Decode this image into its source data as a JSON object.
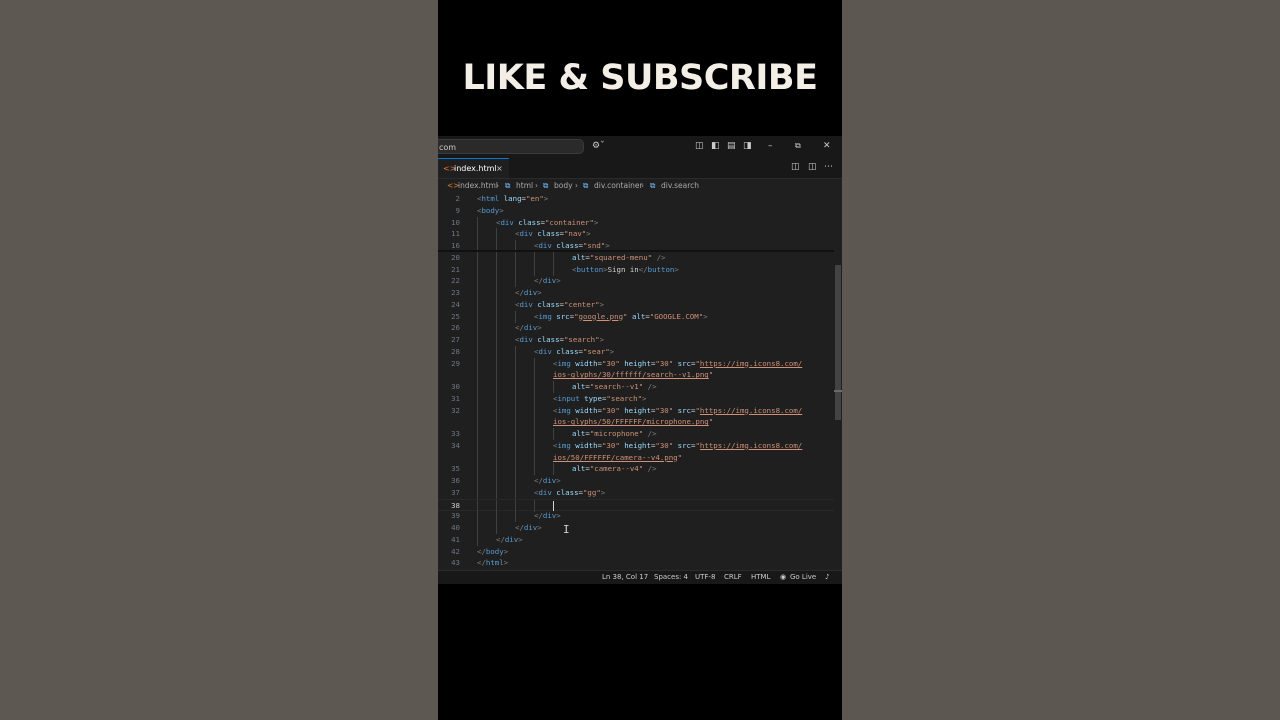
{
  "banner": {
    "text": "LIKE & SUBSCRIBE"
  },
  "titlebar": {
    "command_center_text": "com",
    "copilot_icon": "copilot-icon",
    "layout_icons": [
      "layout-panel-icon",
      "toggle-sidebar-icon",
      "toggle-panel-icon",
      "toggle-secondary-sidebar-icon"
    ],
    "window_controls": [
      "minimize-icon",
      "restore-icon",
      "close-icon"
    ]
  },
  "tab": {
    "label": "index.html",
    "close": "×"
  },
  "breadcrumbs": [
    "index.html",
    "html",
    "body",
    "div.container",
    "div.search"
  ],
  "editor_lines": [
    {
      "n": "2",
      "indent": 0,
      "html": "<span class='p'>&lt;</span><span class='t'>html</span> <span class='a'>lang</span>=<span class='s'>\"en\"</span><span class='p'>&gt;</span>"
    },
    {
      "n": "9",
      "indent": 0,
      "html": "<span class='p'>&lt;</span><span class='t'>body</span><span class='p'>&gt;</span>"
    },
    {
      "n": "10",
      "indent": 1,
      "html": "<span class='p'>&lt;</span><span class='t'>div</span> <span class='a'>class</span>=<span class='s'>\"container\"</span><span class='p'>&gt;</span>"
    },
    {
      "n": "11",
      "indent": 2,
      "html": "<span class='p'>&lt;</span><span class='t'>div</span> <span class='a'>class</span>=<span class='s'>\"nav\"</span><span class='p'>&gt;</span>"
    },
    {
      "n": "16",
      "indent": 3,
      "html": "<span class='p'>&lt;</span><span class='t'>div</span> <span class='a'>class</span>=<span class='s'>\"snd\"</span><span class='p'>&gt;</span>"
    },
    {
      "n": "20",
      "indent": 5,
      "html": "<span class='a'>alt</span>=<span class='s'>\"squared-menu\"</span> <span class='p'>/&gt;</span>"
    },
    {
      "n": "21",
      "indent": 5,
      "html": "<span class='p'>&lt;</span><span class='t'>button</span><span class='p'>&gt;</span><span class='tx'>Sign in</span><span class='p'>&lt;/</span><span class='t'>button</span><span class='p'>&gt;</span>"
    },
    {
      "n": "22",
      "indent": 3,
      "html": "<span class='p'>&lt;/</span><span class='t'>div</span><span class='p'>&gt;</span>"
    },
    {
      "n": "23",
      "indent": 2,
      "html": "<span class='p'>&lt;/</span><span class='t'>div</span><span class='p'>&gt;</span>"
    },
    {
      "n": "24",
      "indent": 2,
      "html": "<span class='p'>&lt;</span><span class='t'>div</span> <span class='a'>class</span>=<span class='s'>\"center\"</span><span class='p'>&gt;</span>"
    },
    {
      "n": "25",
      "indent": 3,
      "html": "<span class='p'>&lt;</span><span class='t'>img</span> <span class='a'>src</span>=<span class='s'>\"</span><span class='u'>google.png</span><span class='s'>\"</span> <span class='a'>alt</span>=<span class='s'>\"GOOGLE.COM\"</span><span class='p'>&gt;</span>"
    },
    {
      "n": "26",
      "indent": 2,
      "html": "<span class='p'>&lt;/</span><span class='t'>div</span><span class='p'>&gt;</span>"
    },
    {
      "n": "27",
      "indent": 2,
      "html": "<span class='p'>&lt;</span><span class='t'>div</span> <span class='a'>class</span>=<span class='s'>\"search\"</span><span class='p'>&gt;</span>"
    },
    {
      "n": "28",
      "indent": 3,
      "html": "<span class='p'>&lt;</span><span class='t'>div</span> <span class='a'>class</span>=<span class='s'>\"sear\"</span><span class='p'>&gt;</span>"
    },
    {
      "n": "29",
      "indent": 4,
      "html": "<span class='p'>&lt;</span><span class='t'>img</span> <span class='a'>width</span>=<span class='s'>\"30\"</span> <span class='a'>height</span>=<span class='s'>\"30\"</span> <span class='a'>src</span>=<span class='s'>\"</span><span class='u'>https://img.icons8.com/</span>"
    },
    {
      "n": "",
      "indent": 4,
      "html": "<span class='u'>ios-glyphs/30/ffffff/search--v1.png</span><span class='s'>\"</span>"
    },
    {
      "n": "30",
      "indent": 5,
      "html": "<span class='a'>alt</span>=<span class='s'>\"search--v1\"</span> <span class='p'>/&gt;</span>"
    },
    {
      "n": "31",
      "indent": 4,
      "html": "<span class='p'>&lt;</span><span class='t'>input</span> <span class='a'>type</span>=<span class='s'>\"search\"</span><span class='p'>&gt;</span>"
    },
    {
      "n": "32",
      "indent": 4,
      "html": "<span class='p'>&lt;</span><span class='t'>img</span> <span class='a'>width</span>=<span class='s'>\"30\"</span> <span class='a'>height</span>=<span class='s'>\"30\"</span> <span class='a'>src</span>=<span class='s'>\"</span><span class='u'>https://img.icons8.com/</span>"
    },
    {
      "n": "",
      "indent": 4,
      "html": "<span class='u'>ios-glyphs/50/FFFFFF/microphone.png</span><span class='s'>\"</span>"
    },
    {
      "n": "33",
      "indent": 5,
      "html": "<span class='a'>alt</span>=<span class='s'>\"microphone\"</span> <span class='p'>/&gt;</span>"
    },
    {
      "n": "34",
      "indent": 4,
      "html": "<span class='p'>&lt;</span><span class='t'>img</span> <span class='a'>width</span>=<span class='s'>\"30\"</span> <span class='a'>height</span>=<span class='s'>\"30\"</span> <span class='a'>src</span>=<span class='s'>\"</span><span class='u'>https://img.icons8.com/</span>"
    },
    {
      "n": "",
      "indent": 4,
      "html": "<span class='u'>ios/50/FFFFFF/camera--v4.png</span><span class='s'>\"</span>"
    },
    {
      "n": "35",
      "indent": 5,
      "html": "<span class='a'>alt</span>=<span class='s'>\"camera--v4\"</span> <span class='p'>/&gt;</span>"
    },
    {
      "n": "36",
      "indent": 3,
      "html": "<span class='p'>&lt;/</span><span class='t'>div</span><span class='p'>&gt;</span>"
    },
    {
      "n": "37",
      "indent": 3,
      "html": "<span class='p'>&lt;</span><span class='t'>div</span> <span class='a'>class</span>=<span class='s'>\"gg\"</span><span class='p'>&gt;</span>"
    },
    {
      "n": "38",
      "indent": 4,
      "html": "<span class='cursor'></span>",
      "active": true
    },
    {
      "n": "39",
      "indent": 3,
      "html": "<span class='p'>&lt;/</span><span class='t'>div</span><span class='p'>&gt;</span>"
    },
    {
      "n": "40",
      "indent": 2,
      "html": "<span class='p'>&lt;/</span><span class='t'>div</span><span class='p'>&gt;</span>"
    },
    {
      "n": "41",
      "indent": 1,
      "html": "<span class='p'>&lt;/</span><span class='t'>div</span><span class='p'>&gt;</span>"
    },
    {
      "n": "42",
      "indent": 0,
      "html": "<span class='p'>&lt;/</span><span class='t'>body</span><span class='p'>&gt;</span>"
    },
    {
      "n": "43",
      "indent": 0,
      "html": "<span class='p'>&lt;/</span><span class='t'>html</span><span class='p'>&gt;</span>"
    }
  ],
  "statusbar": {
    "position": "Ln 38, Col 17",
    "spaces": "Spaces: 4",
    "encoding": "UTF-8",
    "eol": "CRLF",
    "language": "HTML",
    "go_live": "Go Live"
  },
  "colors": {
    "accent": "#0078d4",
    "editor_bg": "#1f1f1f",
    "tag": "#569cd6",
    "attr": "#9cdcfe",
    "string": "#ce9178"
  }
}
